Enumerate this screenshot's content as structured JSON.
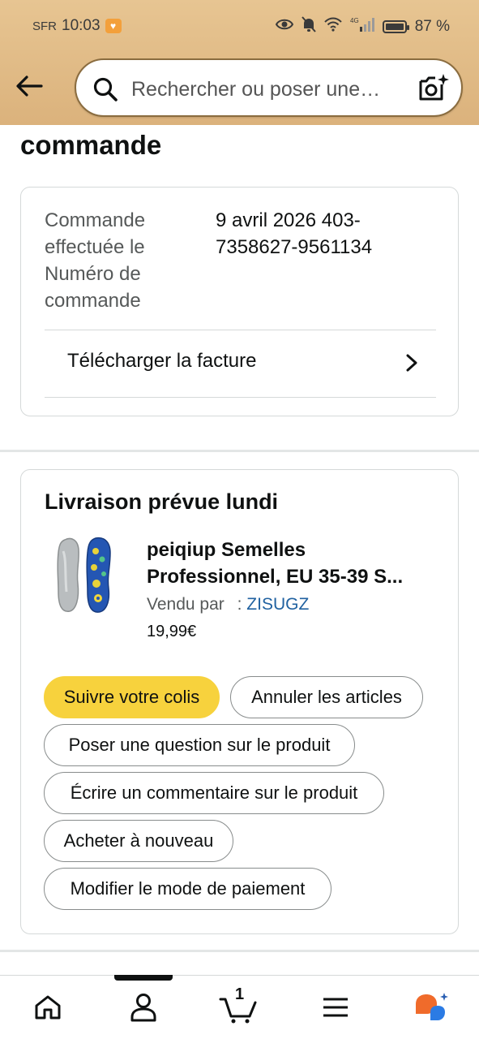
{
  "status_bar": {
    "carrier": "SFR",
    "time": "10:03",
    "network": "4G",
    "battery": "87 %",
    "battery_level": 0.87
  },
  "header": {
    "search_placeholder": "Rechercher ou poser une…",
    "icons": [
      "back-arrow-icon",
      "search-icon",
      "camera-sparkle-icon"
    ]
  },
  "page": {
    "title": "commande"
  },
  "order_info": {
    "labels": "Commande effectuée le Numéro de commande",
    "values": "9 avril 2026 403-7358627-9561134",
    "invoice_link": "Télécharger la facture"
  },
  "shipment": {
    "title": "Livraison prévue lundi",
    "product": {
      "name_line1": "peiqiup Semelles",
      "name_line2": "Professionnel, EU 35-39 S...",
      "sold_by_label": "Vendu par",
      "sold_by_sep": ":",
      "seller": "ZISUGZ",
      "price": "19,99€"
    },
    "actions": {
      "track": "Suivre votre colis",
      "cancel": "Annuler les articles",
      "ask_question": "Poser une question sur le produit",
      "write_review": "Écrire un commentaire sur le produit",
      "buy_again": "Acheter à nouveau",
      "change_payment": "Modifier le mode de paiement"
    }
  },
  "bottom_nav": {
    "cart_count": "1",
    "items": [
      "home-icon",
      "account-icon",
      "cart-icon",
      "menu-icon",
      "rufus-icon"
    ]
  },
  "colors": {
    "header_bg": "#e0b981",
    "primary_button": "#f7d23d",
    "link": "#2162a1",
    "assistant_orange": "#f06b2b",
    "assistant_blue": "#2b7be4"
  }
}
